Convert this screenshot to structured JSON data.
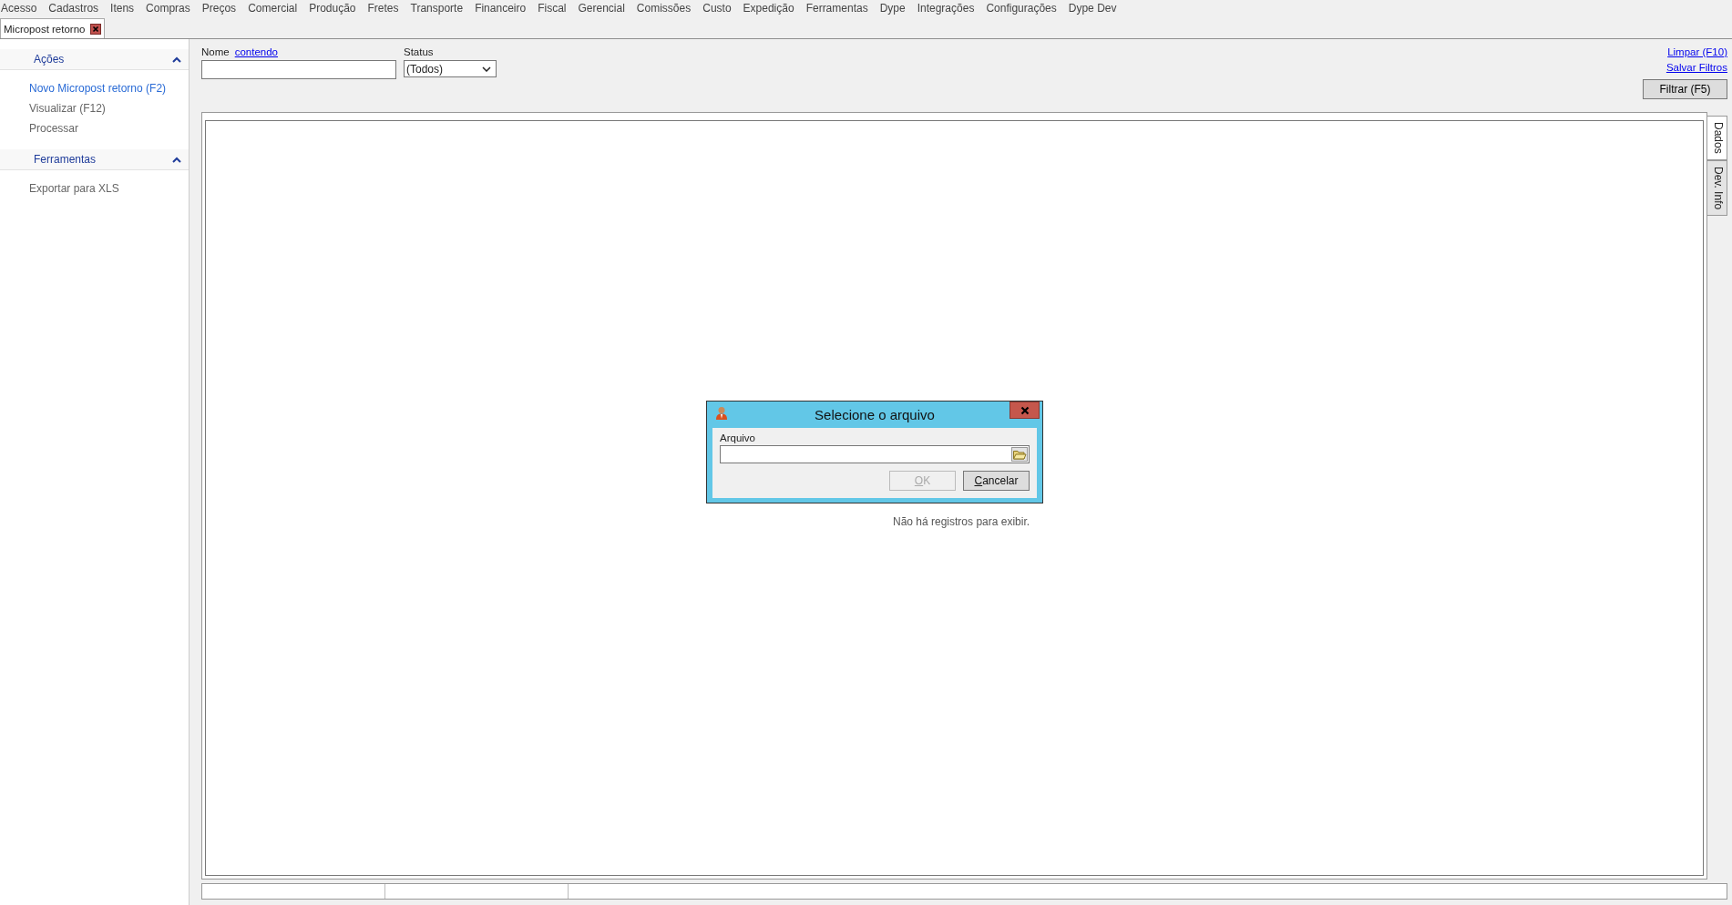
{
  "menu": [
    "Acesso",
    "Cadastros",
    "Itens",
    "Compras",
    "Preços",
    "Comercial",
    "Produção",
    "Fretes",
    "Transporte",
    "Financeiro",
    "Fiscal",
    "Gerencial",
    "Comissões",
    "Custo",
    "Expedição",
    "Ferramentas",
    "Dype",
    "Integrações",
    "Configurações",
    "Dype Dev"
  ],
  "tabs": [
    {
      "label": "Micropost retorno",
      "selected": true
    }
  ],
  "sidebar": {
    "sections": [
      {
        "title": "Ações",
        "expanded": true,
        "items": [
          {
            "label": "Novo Micropost retorno (F2)",
            "selected": true
          },
          {
            "label": "Visualizar (F12)",
            "selected": false
          },
          {
            "label": "Processar",
            "selected": false
          }
        ]
      },
      {
        "title": "Ferramentas",
        "expanded": true,
        "items": [
          {
            "label": "Exportar para XLS",
            "selected": false
          }
        ]
      }
    ]
  },
  "filters": {
    "name_label": "Nome",
    "name_mode_link": "contendo",
    "status_label": "Status",
    "status_value": "(Todos)"
  },
  "links": [
    "Limpar (F10)",
    "Salvar Filtros"
  ],
  "filter_button": "Filtrar (F5)",
  "side_tabs": [
    {
      "label": "Dados",
      "selected": true
    },
    {
      "label": "Dev. Info",
      "selected": false
    }
  ],
  "grid": {
    "empty_message": "Não há registros para exibir."
  },
  "dialog": {
    "title": "Selecione o arquivo",
    "field_label": "Arquivo",
    "buttons": [
      {
        "label": "OK",
        "disabled": true
      },
      {
        "label": "Cancelar",
        "disabled": false
      }
    ]
  }
}
